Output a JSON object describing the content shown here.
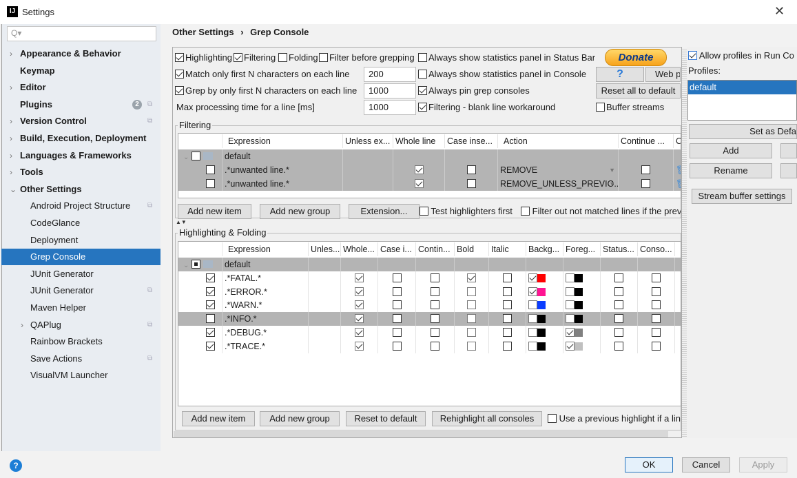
{
  "window": {
    "title": "Settings",
    "icon": "intellij-icon"
  },
  "sidebar": {
    "search_placeholder": "Q▾",
    "items": [
      {
        "label": "Appearance & Behavior",
        "level": "top",
        "arrow": "›"
      },
      {
        "label": "Keymap",
        "level": "top"
      },
      {
        "label": "Editor",
        "level": "top",
        "arrow": "›"
      },
      {
        "label": "Plugins",
        "level": "top",
        "badge": "2",
        "copy": true
      },
      {
        "label": "Version Control",
        "level": "top",
        "arrow": "›",
        "copy": true
      },
      {
        "label": "Build, Execution, Deployment",
        "level": "top",
        "arrow": "›"
      },
      {
        "label": "Languages & Frameworks",
        "level": "top",
        "arrow": "›"
      },
      {
        "label": "Tools",
        "level": "top",
        "arrow": "›"
      },
      {
        "label": "Other Settings",
        "level": "top",
        "arrow": "⌄"
      },
      {
        "label": "Android Project Structure",
        "level": "sub",
        "copy": true
      },
      {
        "label": "CodeGlance",
        "level": "sub"
      },
      {
        "label": "Deployment",
        "level": "sub"
      },
      {
        "label": "Grep Console",
        "level": "sub",
        "selected": true
      },
      {
        "label": "JUnit Generator",
        "level": "sub"
      },
      {
        "label": "JUnit Generator",
        "level": "sub",
        "copy": true
      },
      {
        "label": "Maven Helper",
        "level": "sub"
      },
      {
        "label": "QAPlug",
        "level": "sub",
        "arrow": "›",
        "copy": true
      },
      {
        "label": "Rainbow Brackets",
        "level": "sub"
      },
      {
        "label": "Save Actions",
        "level": "sub",
        "copy": true
      },
      {
        "label": "VisualVM Launcher",
        "level": "sub"
      }
    ]
  },
  "breadcrumb": {
    "parent": "Other Settings",
    "sep": "›",
    "current": "Grep Console"
  },
  "options": {
    "highlighting": {
      "label": "Highlighting",
      "checked": true
    },
    "filtering": {
      "label": "Filtering",
      "checked": true
    },
    "folding": {
      "label": "Folding",
      "checked": false
    },
    "filter_before": {
      "label": "Filter before grepping",
      "checked": false
    },
    "stats_status": {
      "label": "Always show statistics panel in Status Bar",
      "checked": false
    },
    "match_first": {
      "label": "Match only first N characters on each line",
      "checked": true,
      "value": "200"
    },
    "grep_first": {
      "label": "Grep by only first N characters on each line",
      "checked": true,
      "value": "1000"
    },
    "max_time": {
      "label": "Max processing time for a line [ms]",
      "value": "1000"
    },
    "stats_console": {
      "label": "Always show statistics panel in Console",
      "checked": false
    },
    "pin": {
      "label": "Always pin grep consoles",
      "checked": true
    },
    "blank": {
      "label": "Filtering - blank line workaround",
      "checked": true
    },
    "buffer": {
      "label": "Buffer streams",
      "checked": false
    }
  },
  "buttons": {
    "donate": "Donate",
    "help": "?",
    "web": "Web p",
    "reset_all": "Reset all to default"
  },
  "filtering": {
    "title": "Filtering",
    "columns": [
      "",
      "Expression",
      "Unless ex...",
      "Whole line",
      "Case inse...",
      "Action",
      "Continue ...",
      "C"
    ],
    "group": "default",
    "rows": [
      {
        "enabled": false,
        "expr": ".*unwanted line.*",
        "whole": true,
        "case": false,
        "action": "REMOVE",
        "cont": false
      },
      {
        "enabled": false,
        "expr": ".*unwanted line.*",
        "whole": true,
        "case": false,
        "action": "REMOVE_UNLESS_PREVIO...",
        "cont": false
      }
    ],
    "add_item": "Add new item",
    "add_group": "Add new group",
    "extension": "Extension...",
    "test_first": {
      "label": "Test highlighters first",
      "checked": false
    },
    "filter_out": {
      "label": "Filter out not matched lines if the prev",
      "checked": false
    }
  },
  "highlighting": {
    "title": "Highlighting & Folding",
    "columns": [
      "",
      "Expression",
      "Unles...",
      "Whole...",
      "Case i...",
      "Contin...",
      "Bold",
      "Italic",
      "Backg...",
      "Foreg...",
      "Status...",
      "Conso..."
    ],
    "group": "default",
    "rows": [
      {
        "enabled": true,
        "expr": ".*FATAL.*",
        "whole": true,
        "bold": true,
        "bg_on": true,
        "bg": "#ff0000",
        "fg_on": false,
        "fg": "#000000",
        "grey": false
      },
      {
        "enabled": true,
        "expr": ".*ERROR.*",
        "whole": true,
        "bold": false,
        "bg_on": true,
        "bg": "#ff1493",
        "fg_on": false,
        "fg": "#000000",
        "grey": false
      },
      {
        "enabled": true,
        "expr": ".*WARN.*",
        "whole": true,
        "bold": false,
        "bg_on": false,
        "bg": "#0a3cff",
        "fg_on": false,
        "fg": "#000000",
        "grey": false
      },
      {
        "enabled": false,
        "expr": ".*INFO.*",
        "whole": true,
        "bold": false,
        "bg_on": false,
        "bg": "#000000",
        "fg_on": false,
        "fg": "#000000",
        "grey": true
      },
      {
        "enabled": true,
        "expr": ".*DEBUG.*",
        "whole": true,
        "bold": false,
        "bg_on": false,
        "bg": "#000000",
        "fg_on": true,
        "fg": "#808080",
        "grey": false
      },
      {
        "enabled": true,
        "expr": ".*TRACE.*",
        "whole": true,
        "bold": false,
        "bg_on": false,
        "bg": "#000000",
        "fg_on": true,
        "fg": "#c0c0c0",
        "grey": false
      }
    ],
    "add_item": "Add new item",
    "add_group": "Add new group",
    "reset": "Reset to default",
    "rehighlight": "Rehighlight all consoles",
    "use_previous": {
      "label": "Use a previous highlight if a lin",
      "checked": false
    }
  },
  "profiles": {
    "allow": {
      "label": "Allow profiles in Run Co",
      "checked": true
    },
    "label": "Profiles:",
    "items": [
      "default"
    ],
    "set_default": "Set as Defa",
    "add": "Add",
    "rename": "Rename",
    "stream_buffer": "Stream buffer settings"
  },
  "footer": {
    "ok": "OK",
    "cancel": "Cancel",
    "apply": "Apply"
  },
  "colors": {
    "accent": "#2675bf",
    "selection_row": "#b4b4b4"
  }
}
